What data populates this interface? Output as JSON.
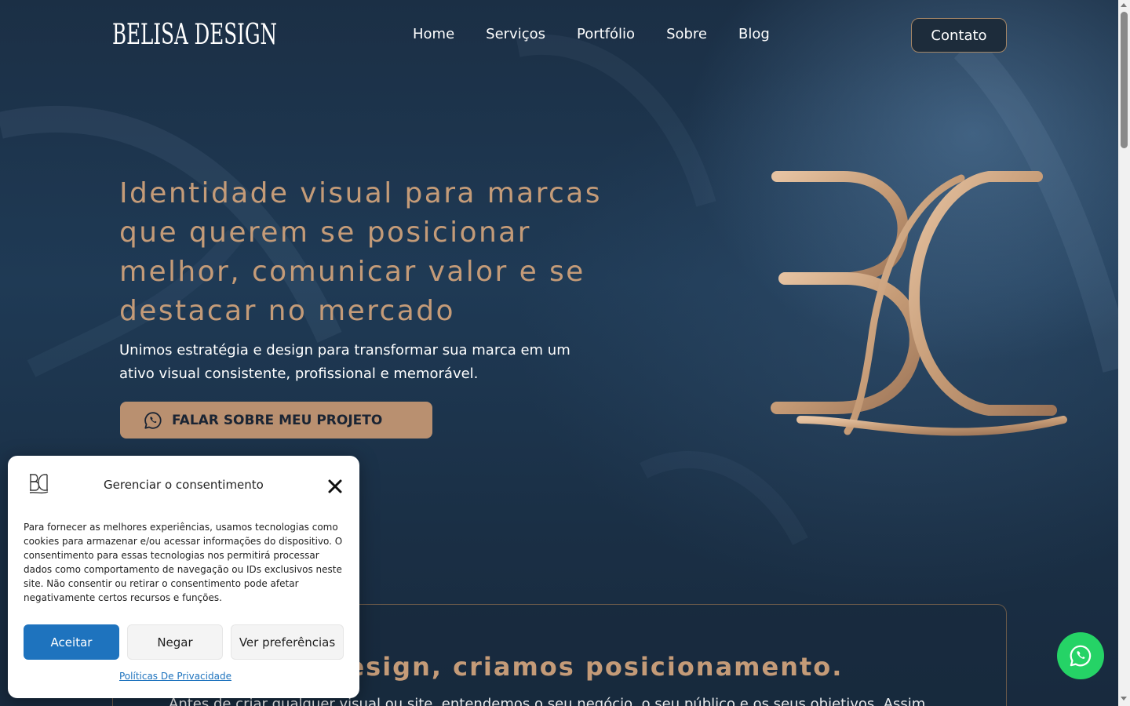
{
  "header": {
    "logo_text": "BELISA DESIGN",
    "nav": [
      "Home",
      "Serviços",
      "Portfólio",
      "Sobre",
      "Blog"
    ],
    "contact_label": "Contato"
  },
  "hero": {
    "title": "Identidade visual para marcas que querem se posicionar melhor, comunicar valor e se destacar no mercado",
    "subtitle": "Unimos estratégia e design para transformar sua marca em um ativo visual consistente, profissional e memorável.",
    "cta_label": "FALAR SOBRE MEU PROJETO",
    "monogram_icon": "belisa-monogram-logo"
  },
  "section": {
    "title": "que design, criamos posicionamento.",
    "text": "Antes de criar qualquer visual ou site, entendemos o seu negócio, o seu público e os seus objetivos. Assim"
  },
  "consent": {
    "title": "Gerenciar o consentimento",
    "body": "Para fornecer as melhores experiências, usamos tecnologias como cookies para armazenar e/ou acessar informações do dispositivo. O consentimento para essas tecnologias nos permitirá processar dados como comportamento de navegação ou IDs exclusivos neste site. Não consentir ou retirar o consentimento pode afetar negativamente certos recursos e funções.",
    "accept": "Aceitar",
    "deny": "Negar",
    "preferences": "Ver preferências",
    "privacy_link": "Políticas De Privacidade"
  },
  "colors": {
    "accent_gold": "#c49b78",
    "cta_bg": "#b99070",
    "background_navy": "#1b2f45",
    "accept_blue": "#1e73be",
    "whatsapp_green": "#25d366"
  },
  "icons": [
    "whatsapp-icon",
    "close-icon",
    "belisa-monogram-logo"
  ]
}
